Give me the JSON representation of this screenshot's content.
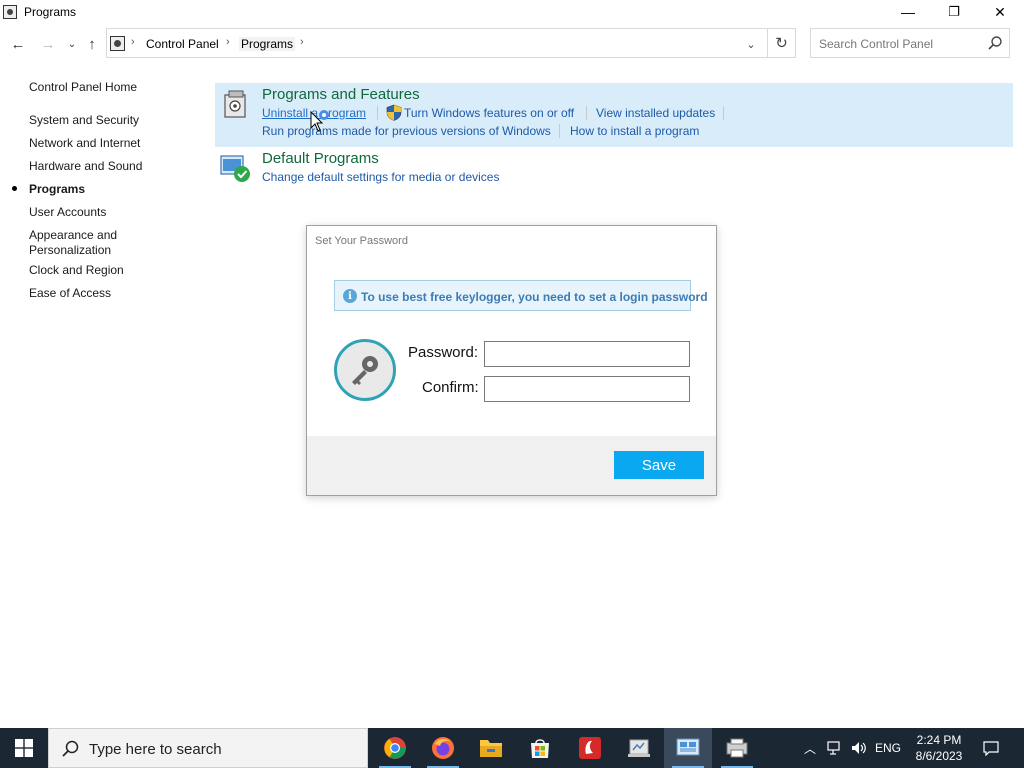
{
  "window": {
    "title": "Programs",
    "controls": {
      "minimize": "—",
      "maximize": "❐",
      "close": "✕"
    }
  },
  "address": {
    "breadcrumbs": [
      "Control Panel",
      "Programs"
    ],
    "search_placeholder": "Search Control Panel"
  },
  "sidebar": {
    "items": [
      {
        "label": "Control Panel Home",
        "active": false
      },
      {
        "label": "System and Security",
        "active": false
      },
      {
        "label": "Network and Internet",
        "active": false
      },
      {
        "label": "Hardware and Sound",
        "active": false
      },
      {
        "label": "Programs",
        "active": true
      },
      {
        "label": "User Accounts",
        "active": false
      },
      {
        "label": "Appearance and Personalization",
        "active": false
      },
      {
        "label": "Clock and Region",
        "active": false
      },
      {
        "label": "Ease of Access",
        "active": false
      }
    ]
  },
  "sections": {
    "programs_features": {
      "title": "Programs and Features",
      "links": {
        "uninstall": "Uninstall a program",
        "windows_features": "Turn Windows features on or off",
        "installed_updates": "View installed updates",
        "run_previous": "Run programs made for previous versions of Windows",
        "how_install": "How to install a program"
      }
    },
    "default_programs": {
      "title": "Default Programs",
      "links": {
        "change_defaults": "Change default settings for media or devices"
      }
    }
  },
  "dialog": {
    "title": "Set Your Password",
    "info": "To use best free keylogger, you need to set a login password",
    "password_label": "Password:",
    "confirm_label": "Confirm:",
    "password_value": "",
    "confirm_value": "",
    "save_label": "Save"
  },
  "taskbar": {
    "search_placeholder": "Type here to search",
    "apps": [
      "chrome",
      "firefox",
      "file-explorer",
      "microsoft-store",
      "red-app",
      "document-app",
      "control-panel",
      "printer-app"
    ],
    "active_app": "control-panel",
    "language": "ENG",
    "time": "2:24 PM",
    "date": "8/6/2023"
  },
  "colors": {
    "section_title": "#11683c",
    "link": "#1e5aa8",
    "highlight": "#d9ecf9",
    "save_button": "#0aa8f0",
    "key_ring": "#2fa3b4",
    "taskbar": "#1c2734"
  }
}
